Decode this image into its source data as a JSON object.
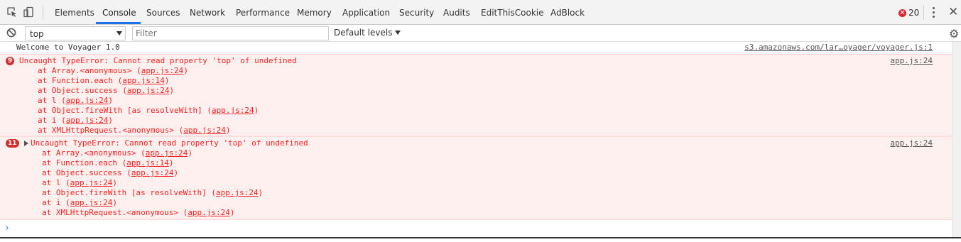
{
  "toolbar": {
    "tabs": [
      "Elements",
      "Console",
      "Sources",
      "Network",
      "Performance",
      "Memory",
      "Application",
      "Security",
      "Audits",
      "EditThisCookie",
      "AdBlock"
    ],
    "active_tab": "Console",
    "error_count": "20",
    "accent_color": "#1a73e8",
    "error_color": "#e0262c"
  },
  "filterbar": {
    "context_value": "top",
    "filter_placeholder": "Filter",
    "levels_label": "Default levels"
  },
  "console": {
    "log_message": "Welcome to Voyager 1.0",
    "log_source": "s3.amazonaws.com/lar…oyager/voyager.js:1",
    "errors": [
      {
        "count": "9",
        "expandable": false,
        "message": "Uncaught TypeError: Cannot read property 'top' of undefined",
        "source": "app.js:24",
        "stack": [
          {
            "prefix": "at Array.<anonymous> (",
            "link": "app.js:24",
            "suffix": ")"
          },
          {
            "prefix": "at Function.each (",
            "link": "app.js:14",
            "suffix": ")"
          },
          {
            "prefix": "at Object.success (",
            "link": "app.js:24",
            "suffix": ")"
          },
          {
            "prefix": "at l (",
            "link": "app.js:24",
            "suffix": ")"
          },
          {
            "prefix": "at Object.fireWith [as resolveWith] (",
            "link": "app.js:24",
            "suffix": ")"
          },
          {
            "prefix": "at i (",
            "link": "app.js:24",
            "suffix": ")"
          },
          {
            "prefix": "at XMLHttpRequest.<anonymous> (",
            "link": "app.js:24",
            "suffix": ")"
          }
        ]
      },
      {
        "count": "11",
        "expandable": true,
        "message": "Uncaught TypeError: Cannot read property 'top' of undefined",
        "source": "app.js:24",
        "stack": [
          {
            "prefix": "at Array.<anonymous> (",
            "link": "app.js:24",
            "suffix": ")"
          },
          {
            "prefix": "at Function.each (",
            "link": "app.js:14",
            "suffix": ")"
          },
          {
            "prefix": "at Object.success (",
            "link": "app.js:24",
            "suffix": ")"
          },
          {
            "prefix": "at l (",
            "link": "app.js:24",
            "suffix": ")"
          },
          {
            "prefix": "at Object.fireWith [as resolveWith] (",
            "link": "app.js:24",
            "suffix": ")"
          },
          {
            "prefix": "at i (",
            "link": "app.js:24",
            "suffix": ")"
          },
          {
            "prefix": "at XMLHttpRequest.<anonymous> (",
            "link": "app.js:24",
            "suffix": ")"
          }
        ]
      }
    ],
    "prompt_symbol": "›"
  }
}
